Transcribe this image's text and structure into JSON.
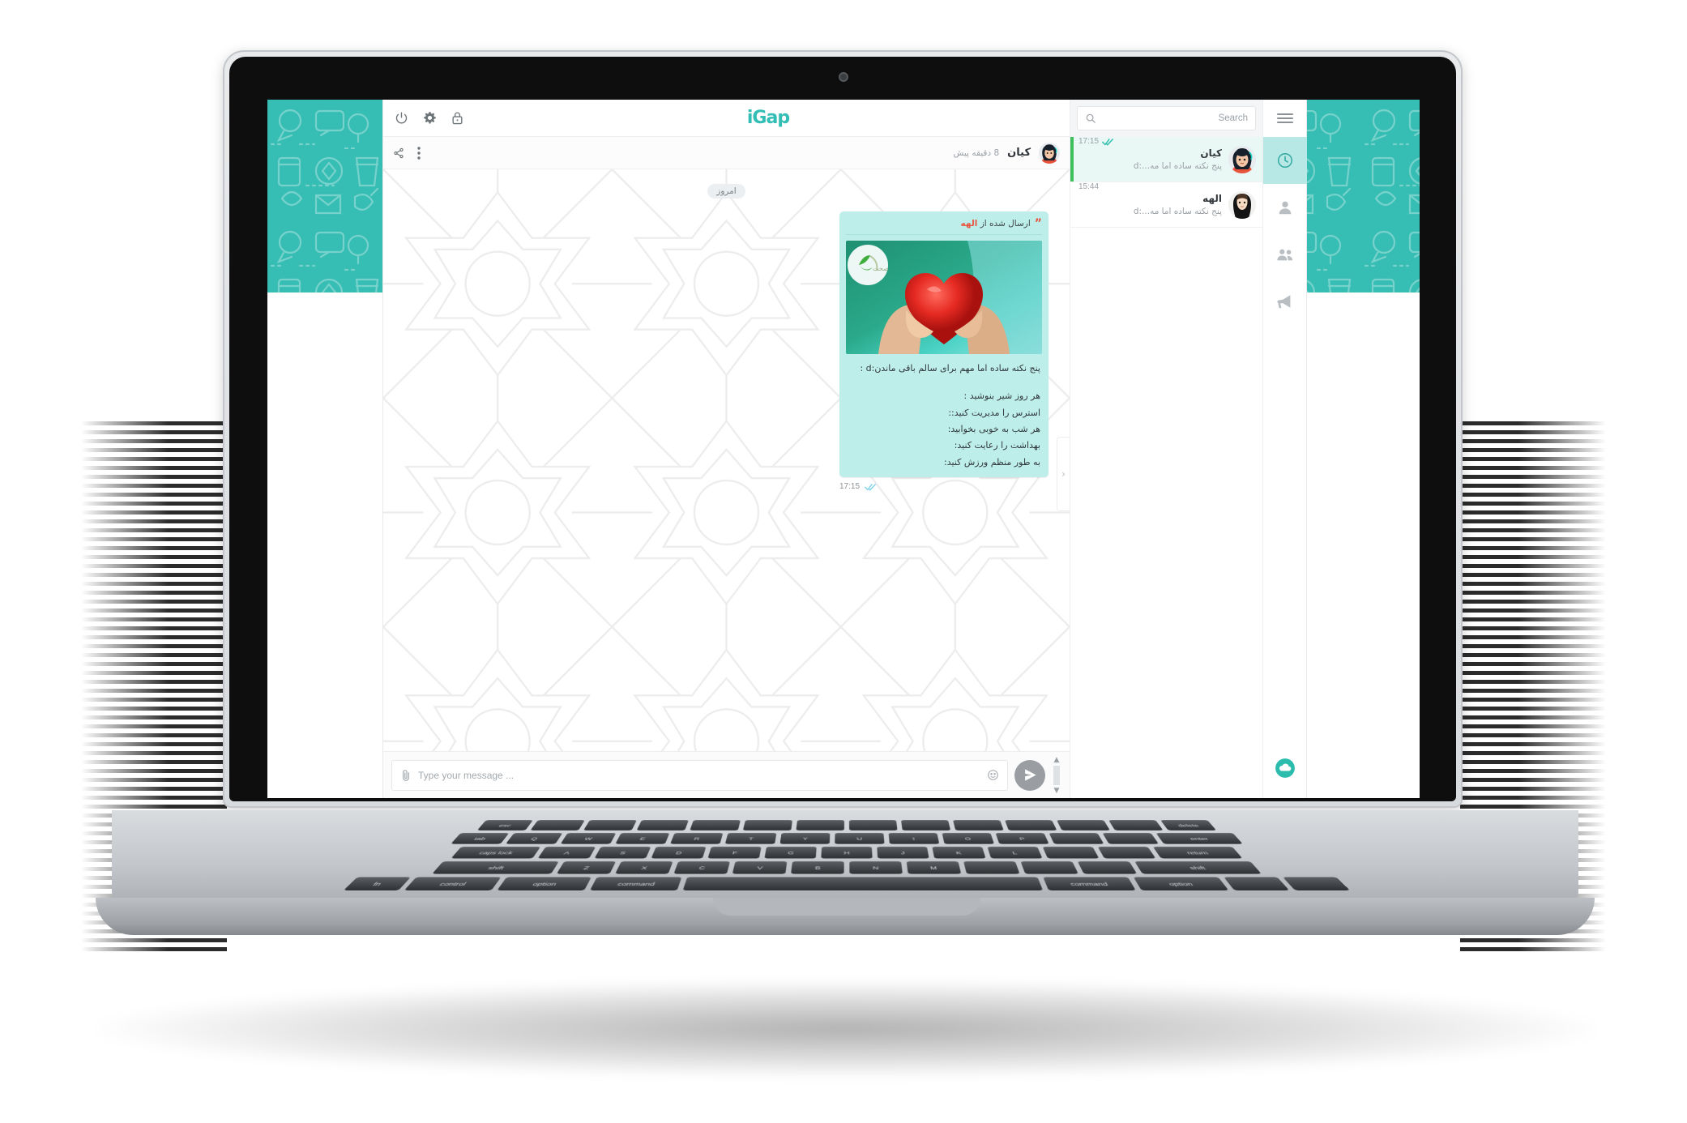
{
  "app": {
    "logo_text": "iGap",
    "accent_color": "#32bdb5",
    "bubble_color": "#bdeeea",
    "selected_row_color": "#e9f7f5",
    "selected_marker_color": "#3fbf5c"
  },
  "topbar": {
    "power_icon": "power-icon",
    "settings_icon": "gear-icon",
    "lock_icon": "lock-icon",
    "menu_icon": "hamburger-menu-icon"
  },
  "chat_header": {
    "name": "کیان",
    "last_seen": "8 دقیقه پیش",
    "more_icon": "more-vertical-icon",
    "share_icon": "share-icon",
    "avatar": "avatar-kian"
  },
  "search": {
    "placeholder": "Search",
    "icon": "search-icon"
  },
  "chat_list": [
    {
      "name": "کیان",
      "preview": "پنج نکته ساده اما مه...:d",
      "time": "17:15",
      "status_icon": "double-check-icon",
      "selected": true
    },
    {
      "name": "الهه",
      "preview": "پنج نکته ساده اما مه...:d",
      "time": "15:44",
      "status_icon": "",
      "selected": false
    }
  ],
  "conversation": {
    "day_label": "امروز",
    "message": {
      "forwarded_prefix": "ارسال شده از",
      "forwarded_from": "الهه",
      "quote_glyph": "”",
      "image_alt": "hands-holding-red-heart-photo",
      "lead_line": "پنج نکته ساده اما مهم برای سالم باقی ماندن:d :",
      "lines": [
        "هر روز شیر بنوشید : ",
        "استرس را مدیریت کنید::",
        "هر شب به خوبی بخوابید:",
        "بهداشت را رعایت کنید:",
        "به طور منظم ورزش کنید:"
      ],
      "time": "17:15",
      "status_icon": "double-check-icon"
    }
  },
  "composer": {
    "placeholder": "Type your message ...",
    "attach_icon": "paperclip-icon",
    "emoji_icon": "smiley-icon",
    "send_icon": "send-icon"
  },
  "rail": {
    "items": [
      {
        "icon": "clock-icon",
        "name": "recent-chats",
        "active": true
      },
      {
        "icon": "person-icon",
        "name": "contacts",
        "active": false
      },
      {
        "icon": "group-icon",
        "name": "groups",
        "active": false
      },
      {
        "icon": "megaphone-icon",
        "name": "channels",
        "active": false
      }
    ],
    "bottom_icon": "cloud-icon"
  },
  "collapse": {
    "icon": "chevron-right-icon"
  },
  "keyboard": {
    "row1": [
      "esc",
      "",
      "",
      "",
      "",
      "",
      "",
      "",
      "",
      "",
      "",
      "",
      "",
      "delete"
    ],
    "row2": [
      "tab",
      "Q",
      "W",
      "E",
      "R",
      "T",
      "Y",
      "U",
      "I",
      "O",
      "P",
      "",
      "",
      "enter"
    ],
    "row3": [
      "caps lock",
      "A",
      "S",
      "D",
      "F",
      "G",
      "H",
      "J",
      "K",
      "L",
      "",
      "",
      "return"
    ],
    "row4": [
      "shift",
      "Z",
      "X",
      "C",
      "V",
      "B",
      "N",
      "M",
      "",
      "",
      "",
      "shift"
    ],
    "row5": [
      "fn",
      "control",
      "option",
      "command",
      "",
      "command",
      "option",
      "",
      ""
    ]
  }
}
